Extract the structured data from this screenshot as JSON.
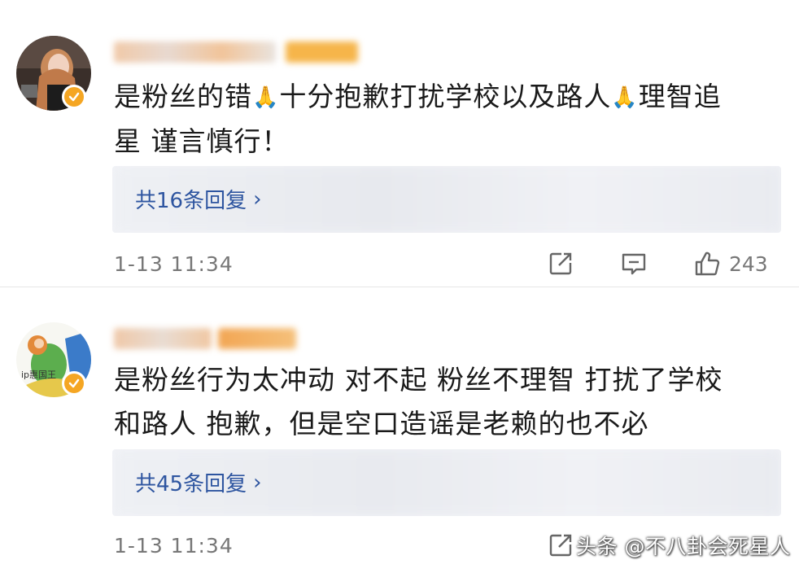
{
  "comments": [
    {
      "text_parts": [
        "是粉丝的错",
        "十分抱歉打扰学校以及路人",
        "理智追\n星 谨言慎行！"
      ],
      "emoji": "🙏",
      "replies_label": "共16条回复",
      "time": "1-13 11:34",
      "like_count": "243"
    },
    {
      "text": "是粉丝行为太冲动 对不起 粉丝不理智 打扰了学校\n和路人 抱歉，但是空口造谣是老赖的也不必",
      "avatar_text": "ip惠国王",
      "replies_label": "共45条回复",
      "time": "1-13 11:34"
    }
  ],
  "reply_chevron": "›",
  "watermark": "头条 @不八卦会死星人",
  "icons": {
    "verified": "verified-badge-icon",
    "share": "share-icon",
    "comment": "comment-icon",
    "like": "thumbs-up-icon"
  },
  "colors": {
    "link": "#2e55a0",
    "verified": "#f5a623",
    "reply_bg": "#f2f3f7",
    "meta": "#777777"
  }
}
